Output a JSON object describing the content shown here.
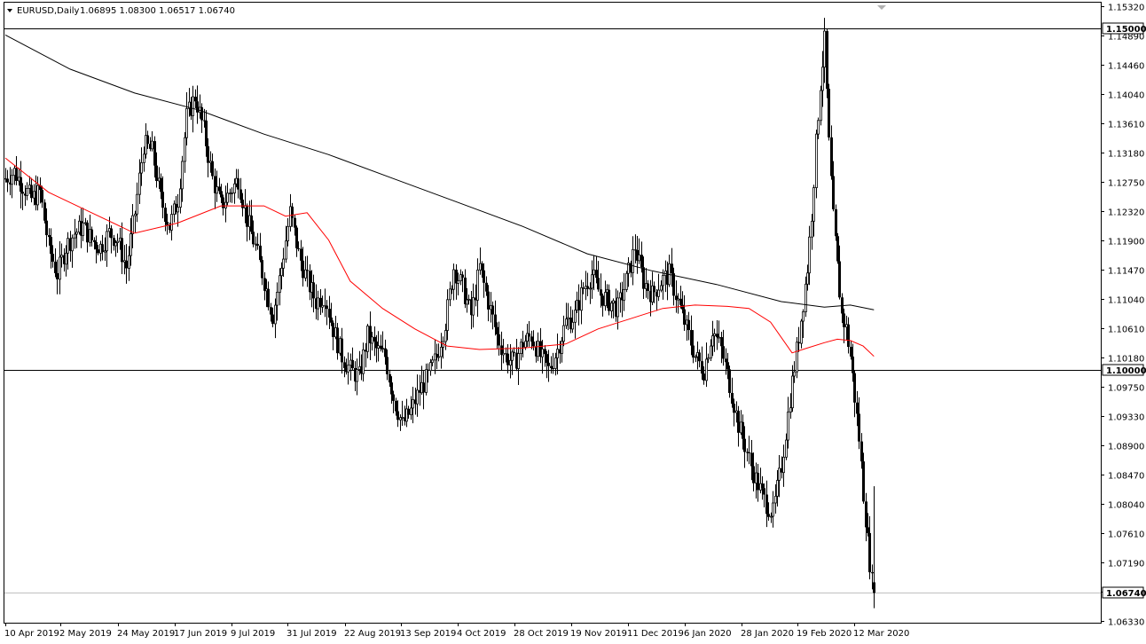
{
  "header": {
    "symbol": "EURUSD,Daily",
    "ohlc": "1.06895 1.08300 1.06517 1.06740"
  },
  "colors": {
    "candle": "#000000",
    "ma_short": "#ff0000",
    "ma_long": "#000000",
    "level_line": "#000000",
    "current_price_line": "#c0c0c0",
    "price_label_bg": "#ffffff"
  },
  "chart_data": {
    "type": "candlestick",
    "title": "EURUSD,Daily",
    "ylim": [
      1.0633,
      1.1532
    ],
    "y_ticks": [
      1.0633,
      1.0676,
      1.0719,
      1.0761,
      1.0804,
      1.0847,
      1.089,
      1.0933,
      1.0975,
      1.1018,
      1.1061,
      1.1104,
      1.1147,
      1.119,
      1.1232,
      1.1275,
      1.1318,
      1.1361,
      1.1404,
      1.1446,
      1.1489,
      1.1532
    ],
    "x_labels": [
      "10 Apr 2019",
      "2 May 2019",
      "24 May 2019",
      "17 Jun 2019",
      "9 Jul 2019",
      "31 Jul 2019",
      "22 Aug 2019",
      "13 Sep 2019",
      "4 Oct 2019",
      "28 Oct 2019",
      "19 Nov 2019",
      "11 Dec 2019",
      "6 Jan 2020",
      "28 Jan 2020",
      "19 Feb 2020",
      "12 Mar 2020"
    ],
    "levels": [
      1.15,
      1.1
    ],
    "current_price": 1.0674,
    "grid": false,
    "close_path": [
      [
        0,
        1.128
      ],
      [
        4,
        1.129
      ],
      [
        8,
        1.127
      ],
      [
        12,
        1.125
      ],
      [
        16,
        1.126
      ],
      [
        20,
        1.118
      ],
      [
        24,
        1.114
      ],
      [
        28,
        1.118
      ],
      [
        32,
        1.12
      ],
      [
        36,
        1.121
      ],
      [
        40,
        1.119
      ],
      [
        44,
        1.118
      ],
      [
        48,
        1.12
      ],
      [
        52,
        1.119
      ],
      [
        56,
        1.115
      ],
      [
        60,
        1.123
      ],
      [
        64,
        1.133
      ],
      [
        68,
        1.132
      ],
      [
        72,
        1.125
      ],
      [
        76,
        1.121
      ],
      [
        80,
        1.125
      ],
      [
        84,
        1.137
      ],
      [
        88,
        1.14
      ],
      [
        92,
        1.135
      ],
      [
        96,
        1.128
      ],
      [
        100,
        1.124
      ],
      [
        104,
        1.126
      ],
      [
        108,
        1.128
      ],
      [
        112,
        1.122
      ],
      [
        116,
        1.118
      ],
      [
        120,
        1.113
      ],
      [
        124,
        1.108
      ],
      [
        128,
        1.115
      ],
      [
        132,
        1.123
      ],
      [
        136,
        1.117
      ],
      [
        140,
        1.113
      ],
      [
        144,
        1.11
      ],
      [
        148,
        1.111
      ],
      [
        152,
        1.106
      ],
      [
        156,
        1.102
      ],
      [
        160,
        1.1
      ],
      [
        164,
        1.099
      ],
      [
        168,
        1.105
      ],
      [
        172,
        1.103
      ],
      [
        176,
        1.102
      ],
      [
        180,
        1.096
      ],
      [
        184,
        1.092
      ],
      [
        188,
        1.094
      ],
      [
        192,
        1.097
      ],
      [
        196,
        1.099
      ],
      [
        200,
        1.102
      ],
      [
        204,
        1.107
      ],
      [
        208,
        1.115
      ],
      [
        212,
        1.112
      ],
      [
        216,
        1.108
      ],
      [
        220,
        1.115
      ],
      [
        224,
        1.11
      ],
      [
        228,
        1.105
      ],
      [
        232,
        1.102
      ],
      [
        236,
        1.101
      ],
      [
        240,
        1.104
      ],
      [
        244,
        1.105
      ],
      [
        248,
        1.102
      ],
      [
        252,
        1.1
      ],
      [
        256,
        1.103
      ],
      [
        260,
        1.107
      ],
      [
        264,
        1.108
      ],
      [
        268,
        1.112
      ],
      [
        272,
        1.114
      ],
      [
        276,
        1.111
      ],
      [
        280,
        1.11
      ],
      [
        284,
        1.109
      ],
      [
        288,
        1.113
      ],
      [
        292,
        1.118
      ],
      [
        296,
        1.113
      ],
      [
        300,
        1.111
      ],
      [
        304,
        1.113
      ],
      [
        308,
        1.114
      ],
      [
        312,
        1.11
      ],
      [
        316,
        1.106
      ],
      [
        320,
        1.102
      ],
      [
        324,
        1.1
      ],
      [
        328,
        1.106
      ],
      [
        332,
        1.103
      ],
      [
        336,
        1.098
      ],
      [
        340,
        1.092
      ],
      [
        344,
        1.088
      ],
      [
        348,
        1.084
      ],
      [
        352,
        1.081
      ],
      [
        356,
        1.079
      ],
      [
        360,
        1.086
      ],
      [
        364,
        1.096
      ],
      [
        368,
        1.105
      ],
      [
        372,
        1.115
      ],
      [
        374,
        1.123
      ],
      [
        376,
        1.133
      ],
      [
        378,
        1.142
      ],
      [
        380,
        1.148
      ],
      [
        382,
        1.133
      ],
      [
        384,
        1.122
      ],
      [
        386,
        1.115
      ],
      [
        388,
        1.108
      ],
      [
        390,
        1.106
      ],
      [
        392,
        1.102
      ],
      [
        394,
        1.096
      ],
      [
        396,
        1.09
      ],
      [
        398,
        1.082
      ],
      [
        400,
        1.075
      ],
      [
        402,
        1.0689
      ],
      [
        403,
        1.0674
      ]
    ],
    "series": [
      {
        "name": "",
        "type": "ma",
        "period": 50,
        "color": "#ff0000",
        "points": [
          [
            0,
            1.131
          ],
          [
            20,
            1.126
          ],
          [
            40,
            1.123
          ],
          [
            60,
            1.12
          ],
          [
            80,
            1.1215
          ],
          [
            100,
            1.124
          ],
          [
            120,
            1.124
          ],
          [
            130,
            1.1225
          ],
          [
            140,
            1.123
          ],
          [
            150,
            1.119
          ],
          [
            160,
            1.113
          ],
          [
            175,
            1.109
          ],
          [
            190,
            1.106
          ],
          [
            205,
            1.1035
          ],
          [
            220,
            1.103
          ],
          [
            240,
            1.1032
          ],
          [
            260,
            1.1038
          ],
          [
            275,
            1.106
          ],
          [
            290,
            1.1075
          ],
          [
            305,
            1.109
          ],
          [
            320,
            1.1095
          ],
          [
            335,
            1.1093
          ],
          [
            345,
            1.109
          ],
          [
            355,
            1.107
          ],
          [
            365,
            1.1025
          ],
          [
            372,
            1.1032
          ],
          [
            380,
            1.104
          ],
          [
            386,
            1.1045
          ],
          [
            392,
            1.1043
          ],
          [
            398,
            1.1035
          ],
          [
            403,
            1.102
          ]
        ]
      },
      {
        "name": "",
        "type": "ma",
        "period": 200,
        "color": "#000000",
        "points": [
          [
            0,
            1.149
          ],
          [
            30,
            1.144
          ],
          [
            60,
            1.1405
          ],
          [
            90,
            1.138
          ],
          [
            120,
            1.1345
          ],
          [
            150,
            1.1315
          ],
          [
            180,
            1.128
          ],
          [
            210,
            1.1245
          ],
          [
            240,
            1.121
          ],
          [
            270,
            1.117
          ],
          [
            300,
            1.1145
          ],
          [
            330,
            1.1125
          ],
          [
            360,
            1.11
          ],
          [
            380,
            1.1092
          ],
          [
            392,
            1.1095
          ],
          [
            403,
            1.1088
          ]
        ]
      }
    ]
  }
}
